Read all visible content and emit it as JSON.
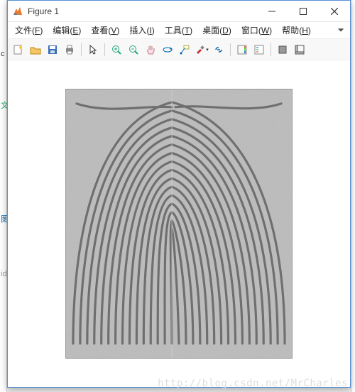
{
  "window": {
    "title": "Figure 1"
  },
  "menu": {
    "file": {
      "label": "文件",
      "hotkey": "F"
    },
    "edit": {
      "label": "编辑",
      "hotkey": "E"
    },
    "view": {
      "label": "查看",
      "hotkey": "V"
    },
    "insert": {
      "label": "插入",
      "hotkey": "I"
    },
    "tools": {
      "label": "工具",
      "hotkey": "T"
    },
    "desktop": {
      "label": "桌面",
      "hotkey": "D"
    },
    "window": {
      "label": "窗口",
      "hotkey": "W"
    },
    "help": {
      "label": "帮助",
      "hotkey": "H"
    }
  },
  "toolbar": {
    "new": "new-figure-icon",
    "open": "open-icon",
    "save": "save-icon",
    "print": "print-icon",
    "pointer": "pointer-icon",
    "zoom_in": "zoom-in-icon",
    "zoom_out": "zoom-out-icon",
    "pan": "pan-icon",
    "rotate": "rotate-3d-icon",
    "datacursor": "data-cursor-icon",
    "brush": "brush-icon",
    "link": "link-data-icon",
    "colorbar": "insert-colorbar-icon",
    "legend": "insert-legend-icon",
    "hide": "hide-plot-tools-icon",
    "show": "show-plot-tools-icon"
  },
  "watermark": "http://blog.csdn.net/MrCharles"
}
